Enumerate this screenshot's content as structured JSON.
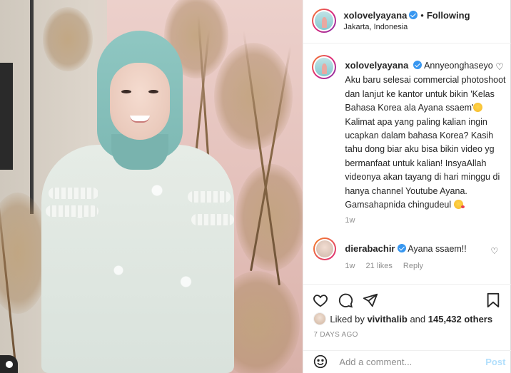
{
  "header": {
    "username": "xolovelyayana",
    "follow_state": "Following",
    "location": "Jakarta, Indonesia"
  },
  "caption": {
    "username": "xolovelyayana",
    "text_part1": "Annyeonghaseyo",
    "text_part2": "Aku baru selesai commercial photoshoot dan lanjut ke kantor untuk bikin 'Kelas Bahasa Korea ala Ayana ssaem'",
    "text_part3": "Kalimat apa yang paling kalian ingin ucapkan dalam bahasa Korea? Kasih tahu dong biar aku bisa bikin video yg bermanfaat untuk kalian! InsyaAllah videonya akan tayang di hari minggu di hanya channel Youtube Ayana. Gamsahapnida chingudeul",
    "time": "1w"
  },
  "reply": {
    "username": "dierabachir",
    "text": "Ayana ssaem!!",
    "time": "1w",
    "likes": "21 likes",
    "reply_label": "Reply"
  },
  "likes": {
    "prefix": "Liked by",
    "user": "vivithalib",
    "and": "and",
    "count": "145,432 others"
  },
  "posted_ago": "7 DAYS AGO",
  "comment_box": {
    "placeholder": "Add a comment...",
    "post_label": "Post"
  },
  "icons": {
    "verified": "verified-badge-icon",
    "like": "heart-icon",
    "comment": "comment-icon",
    "share": "paper-plane-icon",
    "save": "bookmark-icon",
    "emoji": "smiley-icon"
  },
  "colors": {
    "verified_blue": "#3897f0",
    "post_button_disabled": "#b2dffc",
    "muted_text": "#8e8e8e"
  }
}
